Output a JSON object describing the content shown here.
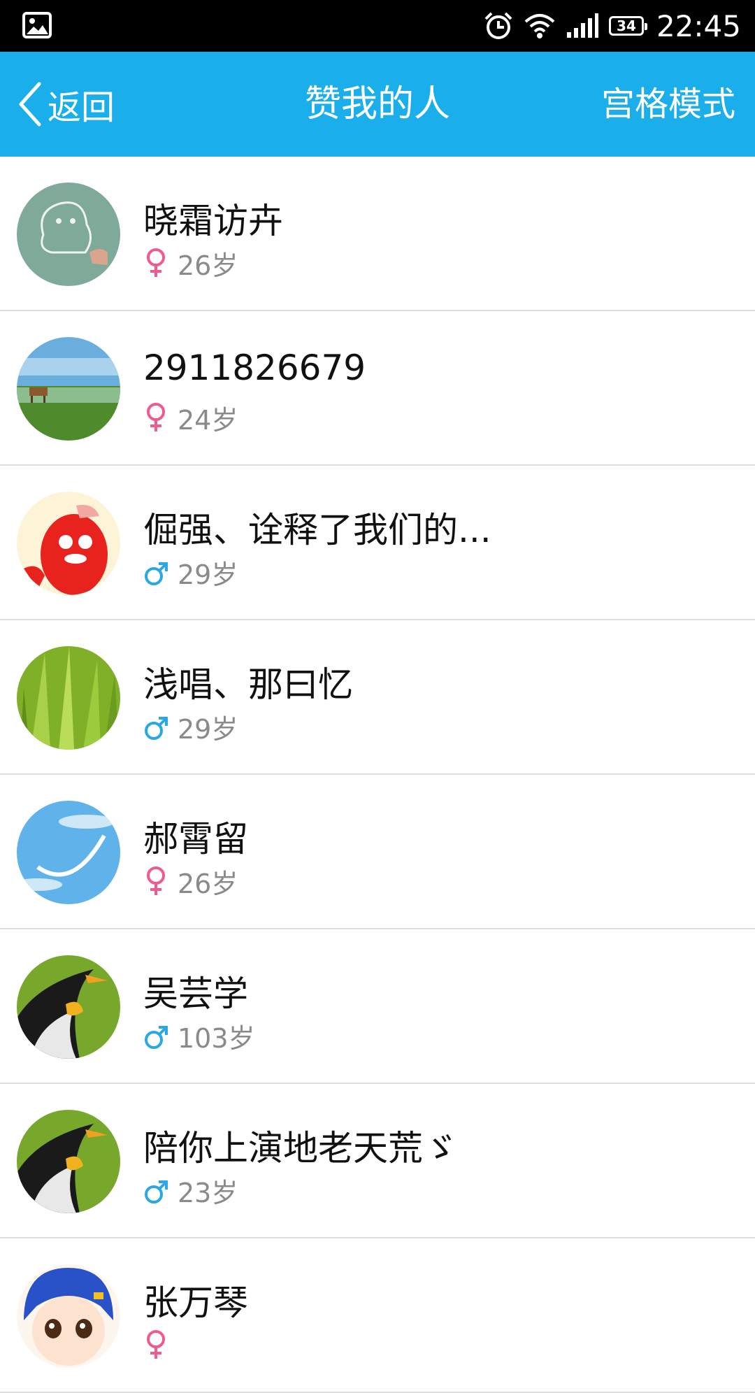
{
  "status_bar": {
    "battery": "34",
    "time": "22:45",
    "icons": [
      "gallery-icon",
      "alarm-icon",
      "wifi-icon",
      "signal-icon",
      "battery-icon"
    ]
  },
  "header": {
    "back_label": "返回",
    "title": "赞我的人",
    "mode_label": "宫格模式",
    "background_color": "#1aaeea"
  },
  "gender_colors": {
    "female": "#f05b8f",
    "male": "#2aa8e6"
  },
  "users": [
    {
      "name": "晓霜访卉",
      "gender": "female",
      "age": "26岁",
      "avatar": "qq-drawing-avatar"
    },
    {
      "name": "2911826679",
      "gender": "female",
      "age": "24岁",
      "avatar": "grassland-cow-avatar"
    },
    {
      "name": "倔强、诠释了我们的...",
      "gender": "male",
      "age": "29岁",
      "avatar": "red-penguin-avatar"
    },
    {
      "name": "浅唱、那曰忆",
      "gender": "male",
      "age": "29岁",
      "avatar": "green-grass-avatar"
    },
    {
      "name": "郝霄留",
      "gender": "female",
      "age": "26岁",
      "avatar": "blue-sky-smile-avatar"
    },
    {
      "name": "吴芸学",
      "gender": "male",
      "age": "103岁",
      "avatar": "penguin-avatar"
    },
    {
      "name": "陪你上演地老天荒ゞ",
      "gender": "male",
      "age": "23岁",
      "avatar": "penguin-avatar"
    },
    {
      "name": "张万琴",
      "gender": "female",
      "age": "",
      "avatar": "cartoon-girl-avatar"
    }
  ]
}
